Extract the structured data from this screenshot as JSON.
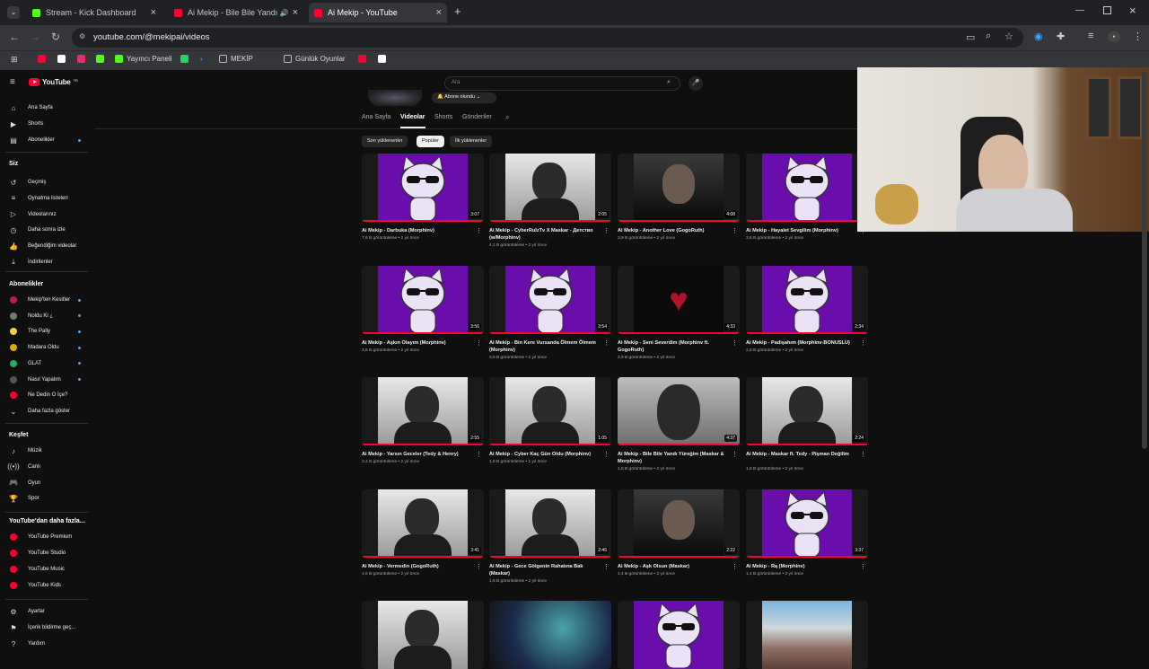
{
  "browser": {
    "tabs": [
      {
        "title": "Stream - Kick Dashboard",
        "color": "#53fc18",
        "active": false
      },
      {
        "title": "Ai Mekip - Bile Bile Yandı Y",
        "color": "#ff0033",
        "active": false
      },
      {
        "title": "Ai Mekip - YouTube",
        "color": "#ff0033",
        "active": true
      }
    ],
    "url": "youtube.com/@mekipai/videos",
    "bookmarks": [
      {
        "label": "",
        "color": "#ff0033"
      },
      {
        "label": "",
        "color": "#ffffff"
      },
      {
        "label": "",
        "color": "#e1306c"
      },
      {
        "label": "",
        "color": "#53fc18"
      },
      {
        "label": "Yayıncı Paneli",
        "color": "#53fc18"
      },
      {
        "label": "",
        "color": "#1ed760"
      },
      {
        "label": "",
        "color": "#3ea6ff"
      },
      {
        "label": "MEKİP",
        "color": "#bbbbbb"
      },
      {
        "label": "Günlük Oyunlar",
        "color": "#bbbbbb"
      },
      {
        "label": "",
        "color": "#ff0033"
      },
      {
        "label": "",
        "color": "#ffffff"
      }
    ]
  },
  "youtube": {
    "logo": "YouTube",
    "logo_region": "TR",
    "search_placeholder": "Ara",
    "subscribe_label": "Abone olundu",
    "channel_tabs": [
      {
        "label": "Ana Sayfa",
        "active": false
      },
      {
        "label": "Videolar",
        "active": true
      },
      {
        "label": "Shorts",
        "active": false
      },
      {
        "label": "Gönderiler",
        "active": false
      }
    ],
    "chips": [
      {
        "label": "Son yüklenenler",
        "selected": false
      },
      {
        "label": "Popüler",
        "selected": true
      },
      {
        "label": "İlk yüklenenler",
        "selected": false
      }
    ]
  },
  "sidebar": {
    "main": [
      {
        "label": "Ana Sayfa",
        "icon": "home-icon"
      },
      {
        "label": "Shorts",
        "icon": "shorts-icon"
      },
      {
        "label": "Abonelikler",
        "icon": "subscriptions-icon"
      }
    ],
    "you_header": "Siz",
    "you": [
      {
        "label": "Geçmiş",
        "icon": "history-icon"
      },
      {
        "label": "Oynatma listeleri",
        "icon": "playlist-icon"
      },
      {
        "label": "Videolarınız",
        "icon": "your-videos-icon"
      },
      {
        "label": "Daha sonra izle",
        "icon": "watch-later-icon"
      },
      {
        "label": "Beğendiğim videolar",
        "icon": "like-icon"
      },
      {
        "label": "İndirilenler",
        "icon": "download-icon"
      }
    ],
    "subs_header": "Abonelikler",
    "subs": [
      {
        "label": "Mekip'ten Kesitler",
        "color": "#c2185b"
      },
      {
        "label": "Noldu Ki ¿",
        "color": "#777777"
      },
      {
        "label": "The Pally",
        "color": "#f4d03f"
      },
      {
        "label": "Madara Oldu",
        "color": "#d4ac0d"
      },
      {
        "label": "GLAT",
        "color": "#27ae60"
      },
      {
        "label": "Nasıl Yapalım",
        "color": "#555555"
      },
      {
        "label": "Ne Dedin O İçe?",
        "color": "#ff0033"
      }
    ],
    "show_more": "Daha fazla göster",
    "explore_header": "Keşfet",
    "explore": [
      {
        "label": "Müzik",
        "icon": "music-icon"
      },
      {
        "label": "Canlı",
        "icon": "live-icon"
      },
      {
        "label": "Oyun",
        "icon": "gaming-icon"
      },
      {
        "label": "Spor",
        "icon": "sports-icon"
      }
    ],
    "more_header": "YouTube'dan daha fazla...",
    "more": [
      {
        "label": "YouTube Premium"
      },
      {
        "label": "YouTube Studio"
      },
      {
        "label": "YouTube Music"
      },
      {
        "label": "YouTube Kids"
      }
    ],
    "settings": [
      {
        "label": "Ayarlar",
        "icon": "settings-icon"
      },
      {
        "label": "İçerik bildirme geç...",
        "icon": "flag-icon"
      },
      {
        "label": "Yardım",
        "icon": "help-icon"
      }
    ]
  },
  "videos": [
    {
      "title": "Ai Mekip - Darbuka (Morphinv)",
      "meta": "7,6 B görüntüleme • 2 yıl önce",
      "duration": "3:07",
      "thumb": "cat"
    },
    {
      "title": "Ai Mekip - CyberRulzTv X Maskar - Детство (w/Morphinv)",
      "meta": "4,1 B görüntüleme • 2 yıl önce",
      "duration": "2:05",
      "thumb": "photo"
    },
    {
      "title": "Ai Mekip - Another Love (GogoRuth)",
      "meta": "3,9 B görüntüleme • 2 yıl önce",
      "duration": "4:08",
      "thumb": "dark"
    },
    {
      "title": "Ai Mekip - Hayalet Sevgilim (Morphinv)",
      "meta": "3,6 B görüntüleme • 2 yıl önce",
      "duration": "",
      "thumb": "cat"
    },
    {
      "title": "Ai Mekip - Aşkın Olayım (Morphinv)",
      "meta": "3,6 B görüntüleme • 2 yıl önce",
      "duration": "3:56",
      "thumb": "cat"
    },
    {
      "title": "Ai Mekip - Bin Kere Vursanda Ölmem Ölmem (Morphinv)",
      "meta": "3,5 B görüntüleme • 2 yıl önce",
      "duration": "3:54",
      "thumb": "cat"
    },
    {
      "title": "Ai Mekip - Seni Severdim (Morphinv ft. GogoRuth)",
      "meta": "2,9 B görüntüleme • 2 yıl önce",
      "duration": "4:33",
      "thumb": "heart"
    },
    {
      "title": "Ai Mekip - Padişahım (Morphinv-BONUSLU)",
      "meta": "2,8 B görüntüleme • 2 yıl önce",
      "duration": "2:34",
      "thumb": "cat"
    },
    {
      "title": "Ai Mekip - Yarsın Geceler (Tedy & Henry)",
      "meta": "2,4 B görüntüleme • 2 yıl önce",
      "duration": "2:55",
      "thumb": "photo"
    },
    {
      "title": "Ai Mekip - Cyber Kaç Gün Oldu (Morphinv)",
      "meta": "1,9 B görüntüleme • 1 yıl önce",
      "duration": "1:05",
      "thumb": "photo"
    },
    {
      "title": "Ai Mekip - Bile Bile Yandı Yüreğim (Maskar & Morphinv)",
      "meta": "1,8 B görüntüleme • 2 yıl önce",
      "duration": "4:37",
      "thumb": "gray"
    },
    {
      "title": "Ai Mekip - Maskar ft. Tedy - Pişman Değilim",
      "meta": "1,6 B görüntüleme • 2 yıl önce",
      "duration": "2:24",
      "thumb": "photo"
    },
    {
      "title": "Ai Mekip - Vermedin (GogoRuth)",
      "meta": "1,6 B görüntüleme • 2 yıl önce",
      "duration": "3:41",
      "thumb": "photo"
    },
    {
      "title": "Ai Mekip - Gece Gölgenin Rahatına Bak (Maskar)",
      "meta": "1,5 B görüntüleme • 2 yıl önce",
      "duration": "2:46",
      "thumb": "photo"
    },
    {
      "title": "Ai Mekip - Aşk Olsun (Maskar)",
      "meta": "1,4 B görüntüleme • 2 yıl önce",
      "duration": "2:22",
      "thumb": "dark"
    },
    {
      "title": "Ai Mekip - Rą (Morphinv)",
      "meta": "1,4 B görüntüleme • 2 yıl önce",
      "duration": "3:37",
      "thumb": "cat"
    },
    {
      "title": "",
      "meta": "",
      "duration": "",
      "thumb": "photo"
    },
    {
      "title": "",
      "meta": "",
      "duration": "",
      "thumb": "space"
    },
    {
      "title": "",
      "meta": "",
      "duration": "",
      "thumb": "cat"
    },
    {
      "title": "",
      "meta": "",
      "duration": "",
      "thumb": "landscape"
    }
  ]
}
